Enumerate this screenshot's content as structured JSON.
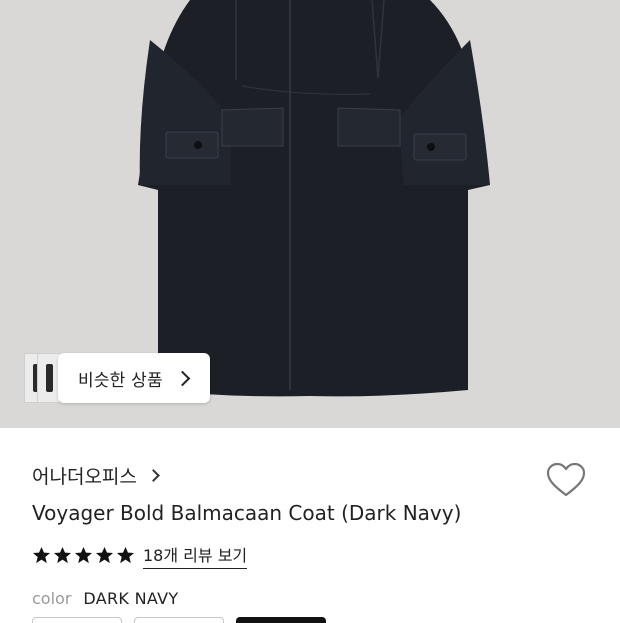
{
  "similar": {
    "label": "비슷한 상품"
  },
  "product": {
    "brand": "어나더오피스",
    "name": "Voyager Bold Balmacaan Coat (Dark Navy)",
    "rating_stars": 5,
    "review_link": "18개 리뷰 보기",
    "color_label": "color",
    "color_value": "DARK NAVY",
    "swatches": [
      "option-1",
      "option-2",
      "option-3"
    ],
    "selected_swatch_index": 2
  },
  "colors": {
    "hero_bg": "#d9d8d6",
    "coat": "#1c1f26",
    "text": "#222222",
    "muted": "#9a9a9a"
  }
}
